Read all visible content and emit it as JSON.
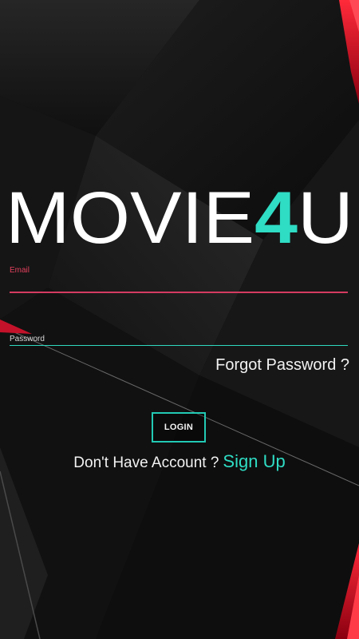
{
  "app": {
    "brand_left": "MOVIE",
    "brand_accent": "4",
    "brand_right": "U",
    "brand_text": "MOVIE4U"
  },
  "login_form": {
    "email_label": "Email",
    "email_value": "",
    "password_label": "Password",
    "password_value": "",
    "forgot_password": "Forgot Password ?",
    "login_button": "LOGIN",
    "signup_prompt": "Don't Have Account ?",
    "signup_link": "Sign Up"
  },
  "colors": {
    "accent_teal": "#2fdcc4",
    "accent_red": "#e2405d",
    "background": "#0d0d0d",
    "text": "#f2f2f2"
  },
  "icons": {
    "logo": "movie4u-logo"
  }
}
